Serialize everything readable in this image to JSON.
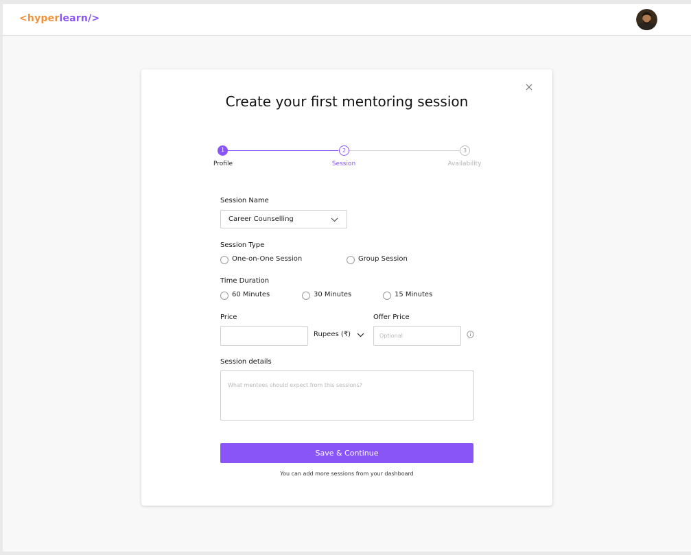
{
  "header": {
    "logo_left": "<hyper",
    "logo_right": "learn/>"
  },
  "modal": {
    "title": "Create your first mentoring session",
    "steps": [
      {
        "number": "1",
        "label": "Profile",
        "state": "completed"
      },
      {
        "number": "2",
        "label": "Session",
        "state": "active"
      },
      {
        "number": "3",
        "label": "Availability",
        "state": "upcoming"
      }
    ],
    "session_name": {
      "label": "Session Name",
      "value": "Career Counselling"
    },
    "session_type": {
      "label": "Session Type",
      "options": [
        "One-on-One Session",
        "Group Session"
      ]
    },
    "time_duration": {
      "label": "Time Duration",
      "options": [
        "60 Minutes",
        "30 Minutes",
        "15 Minutes"
      ]
    },
    "price": {
      "label": "Price",
      "value": "",
      "currency": "Rupees (₹)"
    },
    "offer_price": {
      "label": "Offer Price",
      "placeholder": "Optional"
    },
    "session_details": {
      "label": "Session details",
      "placeholder": "What mentees should expect from this sessions?"
    },
    "submit_label": "Save & Continue",
    "footnote": "You can add more sessions from your dashboard"
  },
  "colors": {
    "accent": "#8a55f7",
    "logo_orange": "#f0913c"
  },
  "icons": {
    "close": "close-icon",
    "dropdown": "chevron-down-icon",
    "info": "info-icon"
  }
}
